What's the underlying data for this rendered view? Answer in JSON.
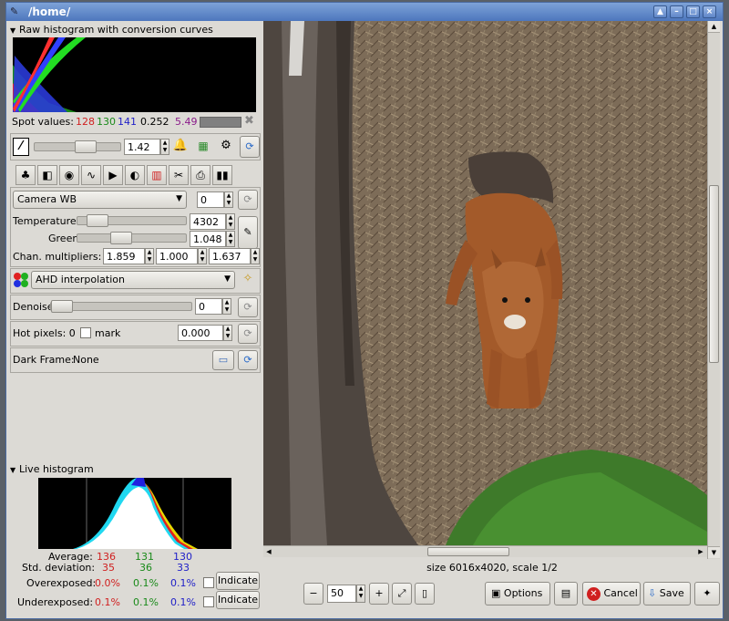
{
  "window": {
    "title": "/home/"
  },
  "raw_histogram": {
    "title": "Raw histogram with conversion curves"
  },
  "spot_values": {
    "label": "Spot values:",
    "r": "128",
    "g": "130",
    "b": "141",
    "lum": "0.252",
    "ev": "5.49"
  },
  "exposure": {
    "value": "1.42"
  },
  "white_balance": {
    "preset": "Camera WB",
    "fine_tune": "0",
    "temperature_label": "Temperature",
    "temperature": "4302",
    "green_label": "Green",
    "green": "1.048",
    "chan_label": "Chan. multipliers:",
    "chan": [
      "1.859",
      "1.000",
      "1.637"
    ]
  },
  "interpolation": {
    "value": "AHD interpolation"
  },
  "denoise": {
    "label": "Denoise",
    "value": "0"
  },
  "hot_pixels": {
    "label": "Hot pixels: 0",
    "mark_label": "mark",
    "value": "0.000"
  },
  "dark_frame": {
    "label": "Dark Frame:",
    "value": "None"
  },
  "live_histogram": {
    "title": "Live histogram",
    "average_label": "Average:",
    "average": [
      "136",
      "131",
      "130"
    ],
    "std_label": "Std. deviation:",
    "std": [
      "35",
      "36",
      "33"
    ],
    "over_label": "Overexposed:",
    "over": [
      "0.0%",
      "0.1%",
      "0.1%"
    ],
    "under_label": "Underexposed:",
    "under": [
      "0.1%",
      "0.1%",
      "0.1%"
    ],
    "indicate_label": "Indicate"
  },
  "status": {
    "text": "size 6016x4020, scale 1/2"
  },
  "zoom": {
    "value": "50"
  },
  "buttons": {
    "options": "Options",
    "cancel": "Cancel",
    "save": "Save"
  },
  "colors": {
    "title_bar": "#5a82c4",
    "panel_bg": "#dcdad5",
    "red": "#d02020",
    "green": "#1a8a1a",
    "blue": "#2020c8"
  }
}
